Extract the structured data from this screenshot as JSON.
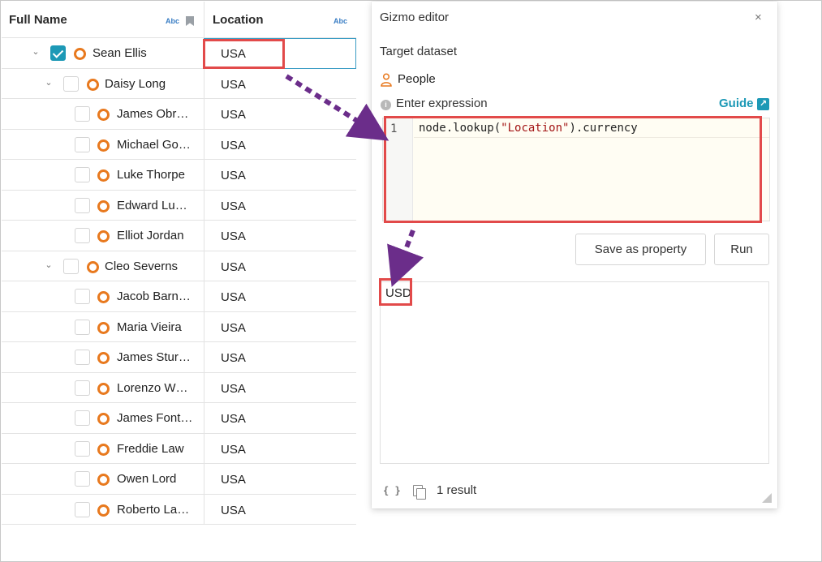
{
  "grid": {
    "columns": [
      {
        "title": "Full Name",
        "type_badge": "Abc",
        "bookmark_icon": "bookmark-icon"
      },
      {
        "title": "Location",
        "type_badge": "Abc"
      }
    ],
    "rows": [
      {
        "name": "Sean Ellis",
        "location": "USA",
        "level": 0,
        "expanded": true,
        "checked": true
      },
      {
        "name": "Daisy Long",
        "location": "USA",
        "level": 1,
        "expanded": true,
        "checked": false
      },
      {
        "name": "James Obr…",
        "location": "USA",
        "level": 2,
        "checked": false
      },
      {
        "name": "Michael Go…",
        "location": "USA",
        "level": 2,
        "checked": false
      },
      {
        "name": "Luke Thorpe",
        "location": "USA",
        "level": 2,
        "checked": false
      },
      {
        "name": "Edward Lu…",
        "location": "USA",
        "level": 2,
        "checked": false
      },
      {
        "name": "Elliot Jordan",
        "location": "USA",
        "level": 2,
        "checked": false
      },
      {
        "name": "Cleo Severns",
        "location": "USA",
        "level": 1,
        "expanded": true,
        "checked": false
      },
      {
        "name": "Jacob Barn…",
        "location": "USA",
        "level": 2,
        "checked": false
      },
      {
        "name": "Maria Vieira",
        "location": "USA",
        "level": 2,
        "checked": false
      },
      {
        "name": "James Stur…",
        "location": "USA",
        "level": 2,
        "checked": false
      },
      {
        "name": "Lorenzo W…",
        "location": "USA",
        "level": 2,
        "checked": false
      },
      {
        "name": "James Font…",
        "location": "USA",
        "level": 2,
        "checked": false
      },
      {
        "name": "Freddie Law",
        "location": "USA",
        "level": 2,
        "checked": false
      },
      {
        "name": "Owen Lord",
        "location": "USA",
        "level": 2,
        "checked": false
      },
      {
        "name": "Roberto La…",
        "location": "USA",
        "level": 2,
        "checked": false
      }
    ]
  },
  "panel": {
    "title": "Gizmo editor",
    "close": "×",
    "target_label": "Target dataset",
    "dataset": "People",
    "expression_label": "Enter expression",
    "info_icon": "i",
    "guide_label": "Guide",
    "guide_icon": "↗",
    "editor": {
      "line_number": "1",
      "code_prefix": "node.lookup(",
      "code_string": "\"Location\"",
      "code_suffix": ").currency"
    },
    "save_button": "Save as property",
    "run_button": "Run",
    "result": "USD",
    "footer": {
      "braces": "{ }",
      "count": "1 result"
    }
  },
  "colors": {
    "accent": "#1d99b6",
    "node_ring": "#e8791e",
    "annotation_box": "#e24a4a",
    "annotation_arrow": "#6b2d8a"
  }
}
